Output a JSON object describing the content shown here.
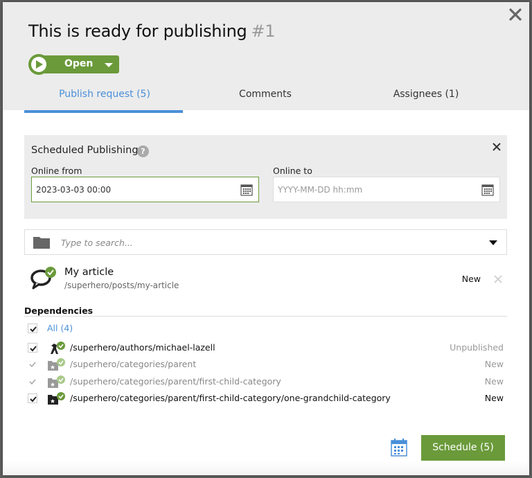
{
  "dialog": {
    "title": "This is ready for publishing",
    "number": "#1",
    "status": {
      "label": "Open",
      "color": "#6a9a3a"
    },
    "close_icon": "close-icon"
  },
  "tabs": [
    {
      "label": "Publish request (5)",
      "active": true
    },
    {
      "label": "Comments",
      "active": false
    },
    {
      "label": "Assignees (1)",
      "active": false
    }
  ],
  "scheduled_publishing": {
    "title": "Scheduled Publishing",
    "help_icon": "?",
    "online_from": {
      "label": "Online from",
      "value": "2023-03-03 00:00"
    },
    "online_to": {
      "label": "Online to",
      "value": "",
      "placeholder": "YYYY-MM-DD hh:mm"
    }
  },
  "search": {
    "placeholder": "Type to search..."
  },
  "item": {
    "name": "My article",
    "path": "/superhero/posts/my-article",
    "status": "New"
  },
  "dependencies": {
    "title": "Dependencies",
    "all_label": "All (4)",
    "rows": [
      {
        "path": "/superhero/authors/michael-lazell",
        "status": "Unpublished",
        "checked": true,
        "disabled": false,
        "icon": "author-icon"
      },
      {
        "path": "/superhero/categories/parent",
        "status": "New",
        "checked": true,
        "disabled": true,
        "icon": "category-icon"
      },
      {
        "path": "/superhero/categories/parent/first-child-category",
        "status": "New",
        "checked": true,
        "disabled": true,
        "icon": "category-icon"
      },
      {
        "path": "/superhero/categories/parent/first-child-category/one-grandchild-category",
        "status": "New",
        "checked": true,
        "disabled": false,
        "icon": "category-icon"
      }
    ]
  },
  "footer": {
    "schedule_label": "Schedule (5)"
  },
  "colors": {
    "accent": "#4a90d9",
    "success": "#6a9a3a",
    "header_bg": "#ececec"
  }
}
